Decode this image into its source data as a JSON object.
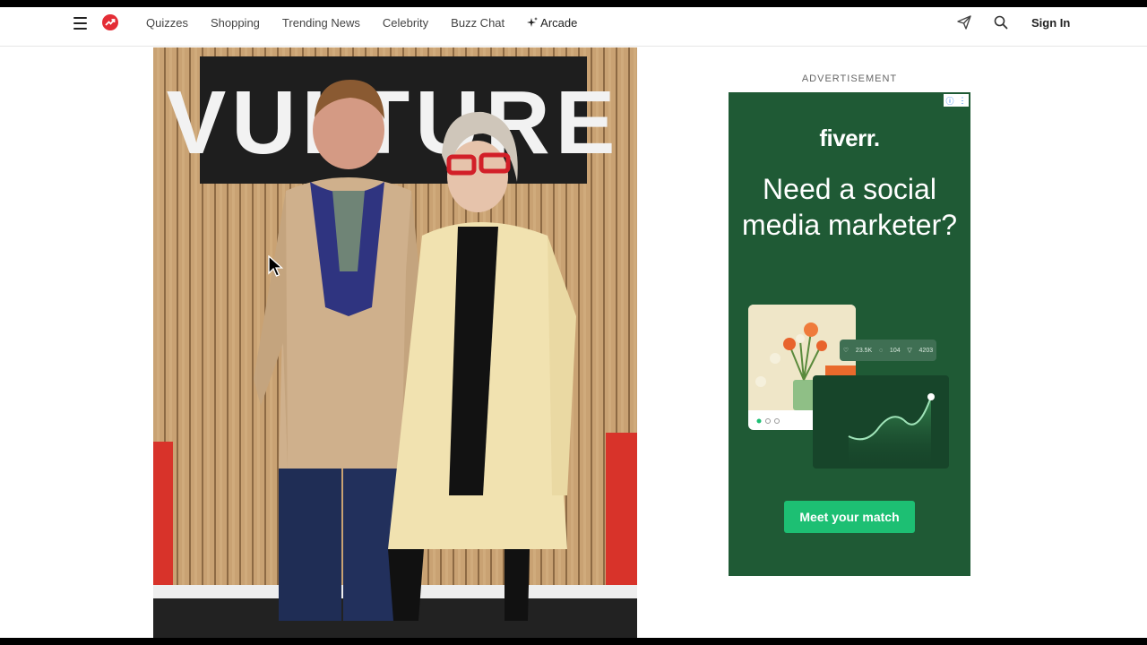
{
  "header": {
    "nav": [
      {
        "id": "quizzes",
        "label": "Quizzes"
      },
      {
        "id": "shopping",
        "label": "Shopping"
      },
      {
        "id": "trending-news",
        "label": "Trending News"
      },
      {
        "id": "celebrity",
        "label": "Celebrity"
      },
      {
        "id": "buzz-chat",
        "label": "Buzz Chat"
      },
      {
        "id": "arcade",
        "label": "Arcade"
      }
    ],
    "sign_in": "Sign In",
    "icons": {
      "menu": "hamburger-menu-icon",
      "logo": "trending-arrow-logo",
      "arcade": "sparkle-icon",
      "send": "paper-plane-icon",
      "search": "search-icon"
    }
  },
  "photo": {
    "backdrop_sign": "VULTURE",
    "colors": {
      "wood": "#c8a070",
      "red_panel": "#d8332a",
      "sign": "#1e1e1e"
    }
  },
  "ad": {
    "label": "ADVERTISEMENT",
    "brand": "fiverr.",
    "headline": "Need a social media marketer?",
    "stats": {
      "likes": "23.5K",
      "comments": "104",
      "shares": "4203"
    },
    "cta": "Meet your match",
    "colors": {
      "background": "#1f5a35",
      "cta": "#1dbf73"
    }
  }
}
